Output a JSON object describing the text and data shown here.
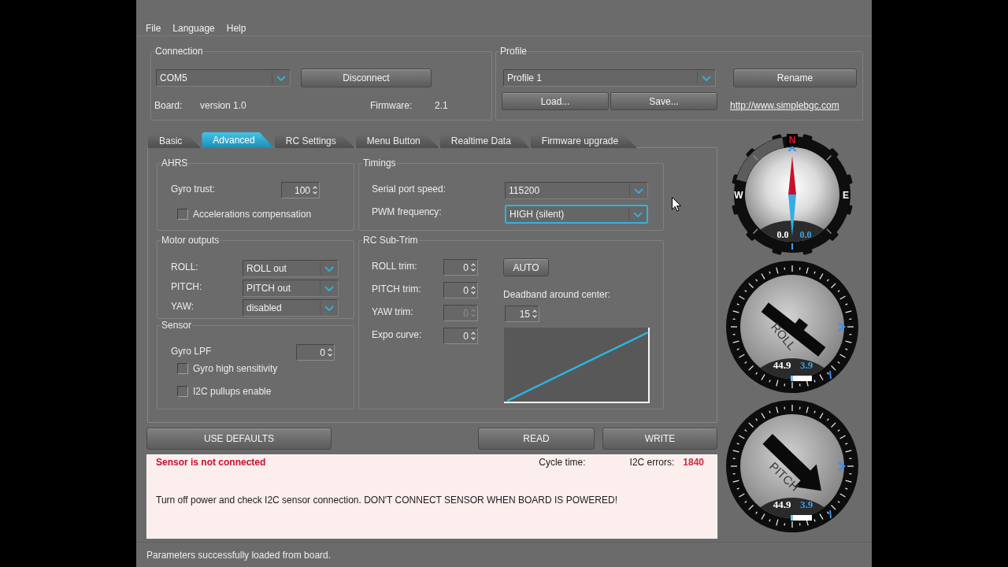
{
  "menu": [
    {
      "label": "File"
    },
    {
      "label": "Language"
    },
    {
      "label": "Help"
    }
  ],
  "connection": {
    "title": "Connection",
    "port": "COM5",
    "button": "Disconnect",
    "board_label": "Board:",
    "board_value": "version 1.0",
    "firmware_label": "Firmware:",
    "firmware_value": "2.1"
  },
  "profile": {
    "title": "Profile",
    "selected_profile": "Profile 1",
    "load_button": "Load...",
    "save_button": "Save...",
    "rename_button": "Rename",
    "link": "http://www.simplebgc.com"
  },
  "tabs": [
    {
      "label": "Basic",
      "selected": false
    },
    {
      "label": "Advanced",
      "selected": true
    },
    {
      "label": "RC Settings",
      "selected": false
    },
    {
      "label": "Menu Button",
      "selected": false
    },
    {
      "label": "Realtime Data",
      "selected": false
    },
    {
      "label": "Firmware upgrade",
      "selected": false
    }
  ],
  "ahrs": {
    "title": "AHRS",
    "gyro_trust": {
      "label": "Gyro trust:",
      "value": "100"
    },
    "checkboxes": [
      {
        "label": "Accelerations compensation",
        "checked": false
      }
    ]
  },
  "motor_outputs": {
    "title": "Motor outputs",
    "rows": [
      {
        "label": "ROLL:",
        "value": "ROLL out"
      },
      {
        "label": "PITCH:",
        "value": "PITCH out"
      },
      {
        "label": "YAW:",
        "value": "disabled"
      }
    ]
  },
  "sensor": {
    "title": "Sensor",
    "gyro_lpf": {
      "label": "Gyro LPF",
      "value": "0"
    },
    "checkboxes": [
      {
        "label": "Gyro high sensitivity",
        "checked": false
      },
      {
        "label": "I2C pullups enable",
        "checked": false
      }
    ]
  },
  "timings": {
    "title": "Timings",
    "fields": [
      {
        "label": "Serial port speed:",
        "value": "115200",
        "focused": false
      },
      {
        "label": "PWM frequency:",
        "value": "HIGH (silent)",
        "focused": true
      }
    ]
  },
  "rc_sub_trim": {
    "title": "RC Sub-Trim",
    "trims": [
      {
        "label": "ROLL trim:",
        "value": "0",
        "disabled": false
      },
      {
        "label": "PITCH trim:",
        "value": "0",
        "disabled": false
      },
      {
        "label": "YAW trim:",
        "value": "0",
        "disabled": true
      },
      {
        "label": "Expo curve:",
        "value": "0",
        "disabled": false
      }
    ],
    "auto_button": "AUTO",
    "deadband": {
      "label": "Deadband around center:",
      "value": "15"
    }
  },
  "gauges": [
    {
      "kind": "compass",
      "north": "N",
      "west": "W",
      "east": "E",
      "readings": [
        "0.0",
        "0.0"
      ]
    },
    {
      "kind": "roll",
      "label": "ROLL",
      "readings": [
        "44.9",
        "3.9"
      ]
    },
    {
      "kind": "pitch",
      "label": "PITCH",
      "readings": [
        "44.9",
        "3.9"
      ]
    }
  ],
  "buttons": [
    {
      "label": "USE DEFAULTS"
    },
    {
      "label": "READ"
    },
    {
      "label": "WRITE"
    }
  ],
  "message": {
    "title": "Sensor is not connected",
    "cycle_time_label": "Cycle time:",
    "i2c_errors_label": "I2C errors:",
    "i2c_errors_value": "1840",
    "text": "Turn off power and check I2C sensor connection. DON'T CONNECT SENSOR WHEN BOARD IS POWERED!"
  },
  "status_bar": {
    "text": "Parameters successfully loaded from board."
  }
}
